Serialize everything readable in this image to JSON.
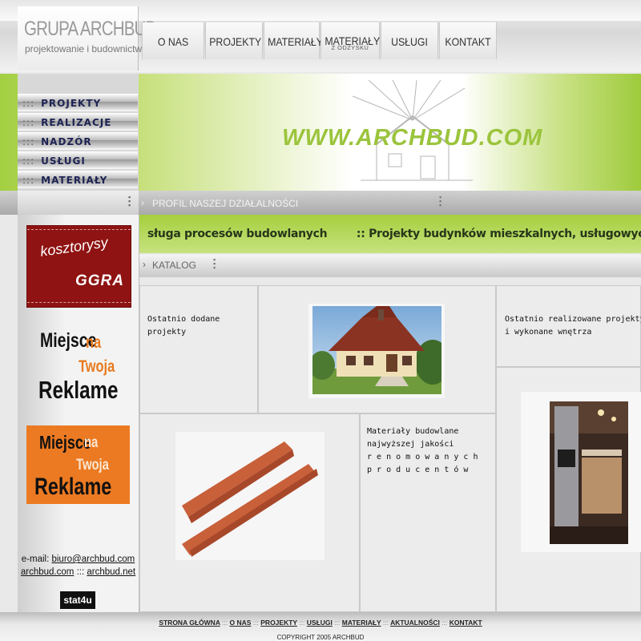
{
  "logo": {
    "title": "GRUPA ARCHBUD",
    "subtitle": "projektowanie i budownictwo"
  },
  "top_nav": [
    {
      "label": "O NAS",
      "sub": ""
    },
    {
      "label": "PROJEKTY",
      "sub": ""
    },
    {
      "label": "MATERIAŁY",
      "sub": ""
    },
    {
      "label": "MATERIAŁY",
      "sub": "Z ODZYSKU"
    },
    {
      "label": "USŁUGI",
      "sub": ""
    },
    {
      "label": "KONTAKT",
      "sub": ""
    }
  ],
  "side_menu": [
    {
      "label": "PROJEKTY"
    },
    {
      "label": "REALIZACJE"
    },
    {
      "label": "NADZÓR"
    },
    {
      "label": "USŁUGI"
    },
    {
      "label": "MATERIAŁY"
    }
  ],
  "side_menu_bullet": ":::",
  "banner": {
    "url": "WWW.ARCHBUD.COM"
  },
  "section_profile": {
    "label": "PROFIL NASZEJ DZIAŁALNOŚCI"
  },
  "marquee": {
    "text": "sługa procesów budowlanych        :: Projekty budynków mieszkalnych, usługowych i"
  },
  "section_catalog": {
    "label": "KATALOG"
  },
  "ads": {
    "kosztorysy": "kosztorysy",
    "ggra": "GGRA",
    "reklama_lines": [
      "Miejsce",
      "na",
      "Twoja",
      "Reklame"
    ]
  },
  "contact": {
    "email_label": "e-mail:",
    "email": "biuro@archbud.com",
    "domain1": "archbud.com",
    "separator": ":::",
    "domain2": "archbud.net"
  },
  "stat_badge": "stat4u",
  "content": {
    "recent_projects": [
      "Ostatnio dodane",
      "projekty"
    ],
    "recent_realizations": [
      "Ostatnio realizowane projekty",
      "i wykonane wnętrza"
    ],
    "materials": [
      "Materiały budowlane",
      "najwyższej jakości",
      "r e n o m o w a n y c h",
      "p r o d u c e n t ó w"
    ]
  },
  "footer": {
    "links": [
      "STRONA GŁÓWNA",
      "O NAS",
      "PROJEKTY",
      "USŁUGI",
      "MATERIAŁY",
      "AKTUALNOŚCI",
      "KONTAKT"
    ],
    "separator": ":::",
    "copyright": "COPYRIGHT 2005 ARCHBUD"
  },
  "colors": {
    "accent_green": "#a6cf3e",
    "menu_text": "#1d2353",
    "ad_red": "#8e1312",
    "ad_orange": "#ec7a22"
  }
}
